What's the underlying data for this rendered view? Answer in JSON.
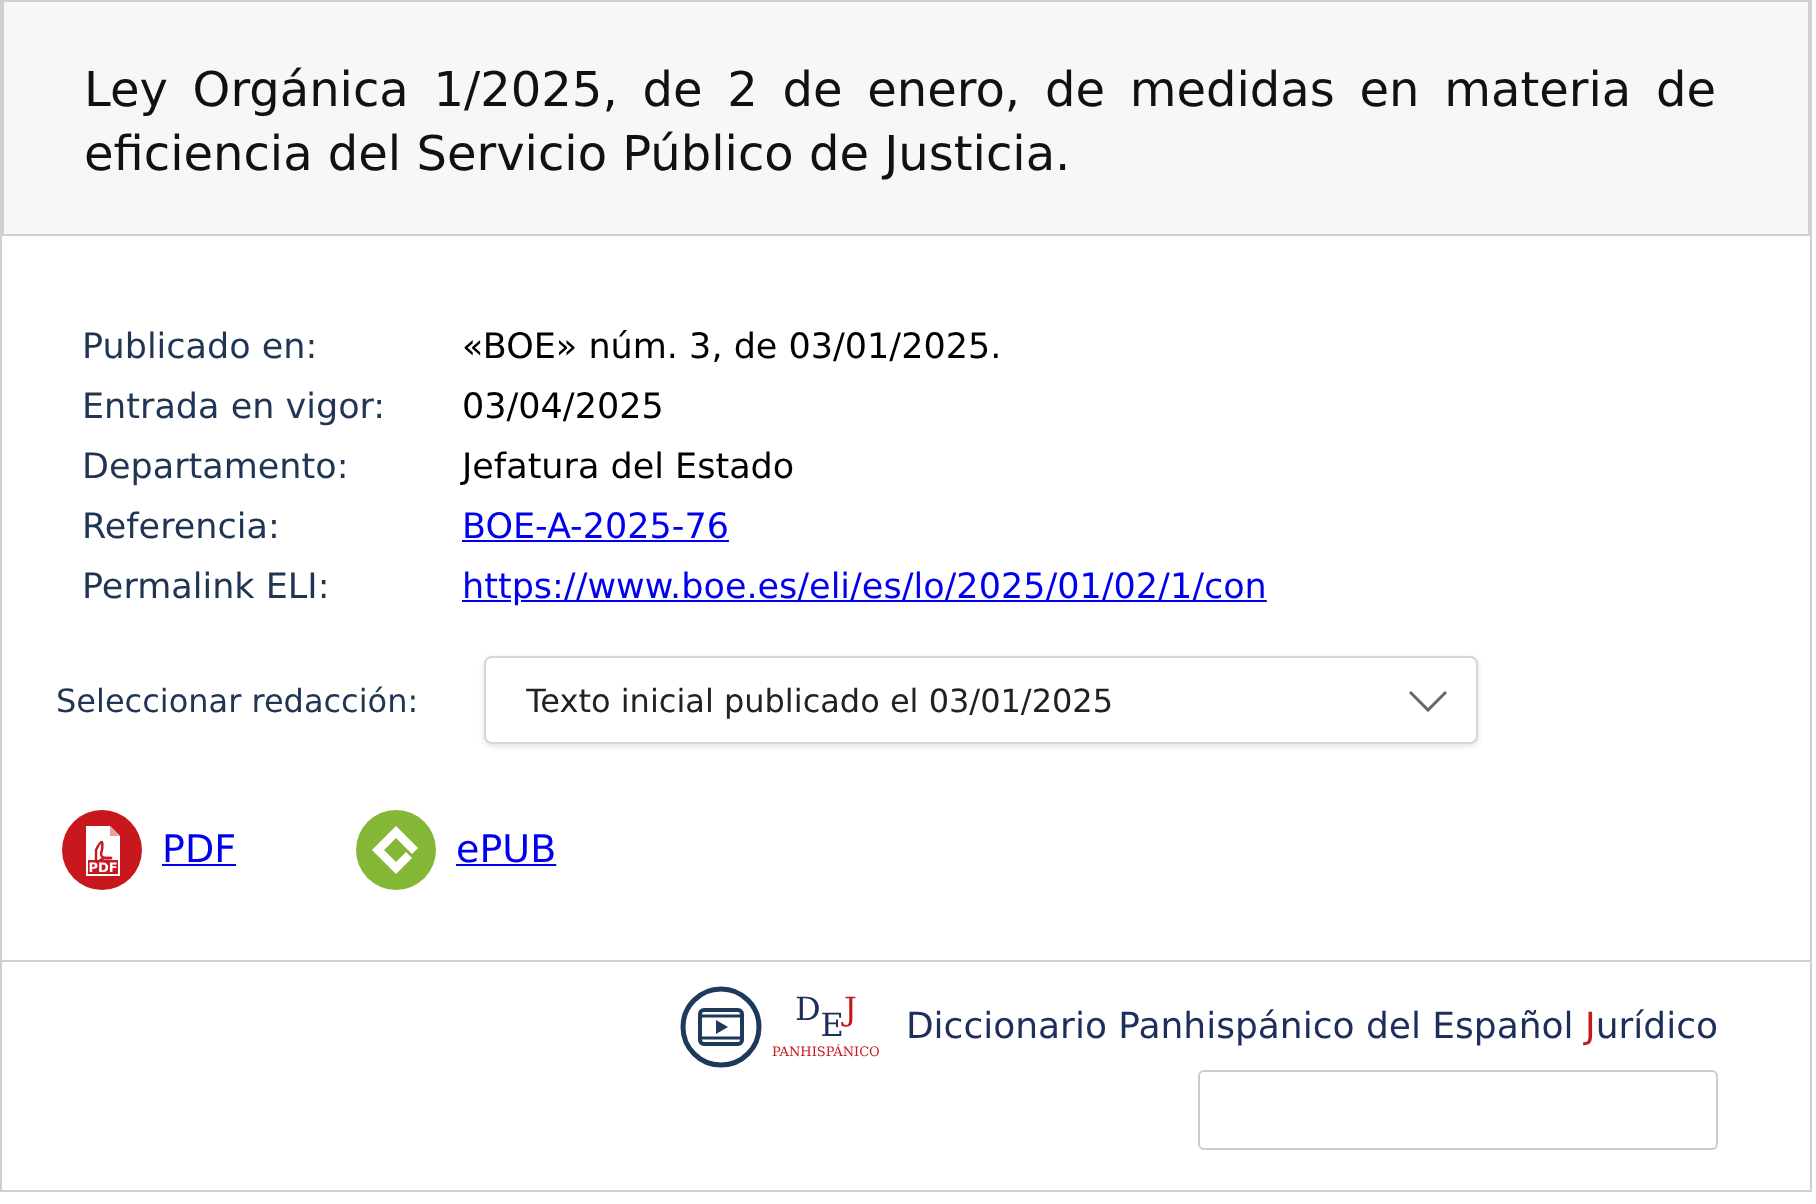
{
  "title": "Ley Orgánica 1/2025, de 2 de enero, de medidas en materia de eficiencia del Servicio Público de Justicia.",
  "metadata": [
    {
      "label": "Publicado en:",
      "value": "«BOE» núm. 3, de 03/01/2025.",
      "kind": "text"
    },
    {
      "label": "Entrada en vigor:",
      "value": "03/04/2025",
      "kind": "text"
    },
    {
      "label": "Departamento:",
      "value": "Jefatura del Estado",
      "kind": "text"
    },
    {
      "label": "Referencia:",
      "value": "BOE-A-2025-76",
      "kind": "link"
    },
    {
      "label": "Permalink ELI:",
      "value": "https://www.boe.es/eli/es/lo/2025/01/02/1/con",
      "kind": "link"
    }
  ],
  "version_select": {
    "label": "Seleccionar redacción:",
    "value": "Texto inicial publicado el 03/01/2025"
  },
  "downloads": [
    {
      "kind": "pdf",
      "label": "PDF",
      "icon_text": "PDF"
    },
    {
      "kind": "epub",
      "label": "ePUB"
    }
  ],
  "dictionary": {
    "logo_letters": [
      "D",
      "E",
      "J"
    ],
    "logo_caption": "PANHISPÁNICO",
    "title": [
      {
        "text": "Diccionario Panhispánico del Español ",
        "accent": false
      },
      {
        "text": "J",
        "accent": true
      },
      {
        "text": "urídico",
        "accent": false
      }
    ]
  }
}
